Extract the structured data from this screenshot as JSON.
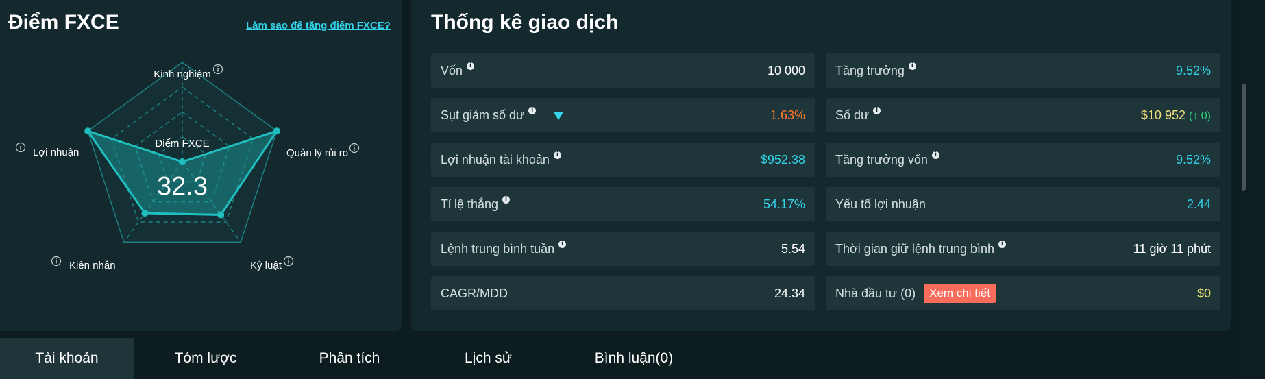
{
  "fxce": {
    "title": "Điểm FXCE",
    "help_link": "Làm sao để tăng điểm FXCE?",
    "center_label": "Điểm FXCE",
    "score": "32.3",
    "axes": [
      "Kinh nghiệm",
      "Quản lý rủi ro",
      "Kỷ luật",
      "Kiên nhẫn",
      "Lợi nhuận"
    ],
    "axis_levels": [
      0.0,
      1.0,
      0.66,
      0.64,
      1.0
    ]
  },
  "stats": {
    "title": "Thống kê giao dịch",
    "left": [
      {
        "label": "Vốn",
        "value": "10 000"
      },
      {
        "label": "Sụt giảm số dư",
        "value": "1.63%"
      },
      {
        "label": "Lợi nhuận tài khoản",
        "value": "$952.38"
      },
      {
        "label": "Tỉ lệ thắng",
        "value": "54.17%"
      },
      {
        "label": "Lệnh trung bình tuần",
        "value": "5.54"
      },
      {
        "label": "CAGR/MDD",
        "value": "24.34"
      }
    ],
    "right": [
      {
        "label": "Tăng trưởng",
        "value": "9.52%"
      },
      {
        "label": "Số dư",
        "value": "$10 952",
        "change": "(↑ 0)"
      },
      {
        "label": "Tăng trưởng vốn",
        "value": "9.52%"
      },
      {
        "label": "Yếu tố lợi nhuận",
        "value": "2.44"
      },
      {
        "label": "Thời gian giữ lệnh trung bình",
        "value": "11 giờ 11 phút"
      },
      {
        "label": "Nhà đầu tư (0)",
        "value": "$0",
        "button": "Xem chi tiết"
      }
    ]
  },
  "tabs": [
    "Tài khoản",
    "Tóm lược",
    "Phân tích",
    "Lịch sử",
    "Bình luận(0)"
  ],
  "info_glyph": "i",
  "colors": {
    "background": "#0c1c1f",
    "panel": "#14292e",
    "accent_cyan": "#33d3e8",
    "negative_orange": "#ff7a2e",
    "balance_yellow": "#f2e27a",
    "radar_stroke": "#1aa3a3",
    "button_red": "#f86c5c"
  }
}
